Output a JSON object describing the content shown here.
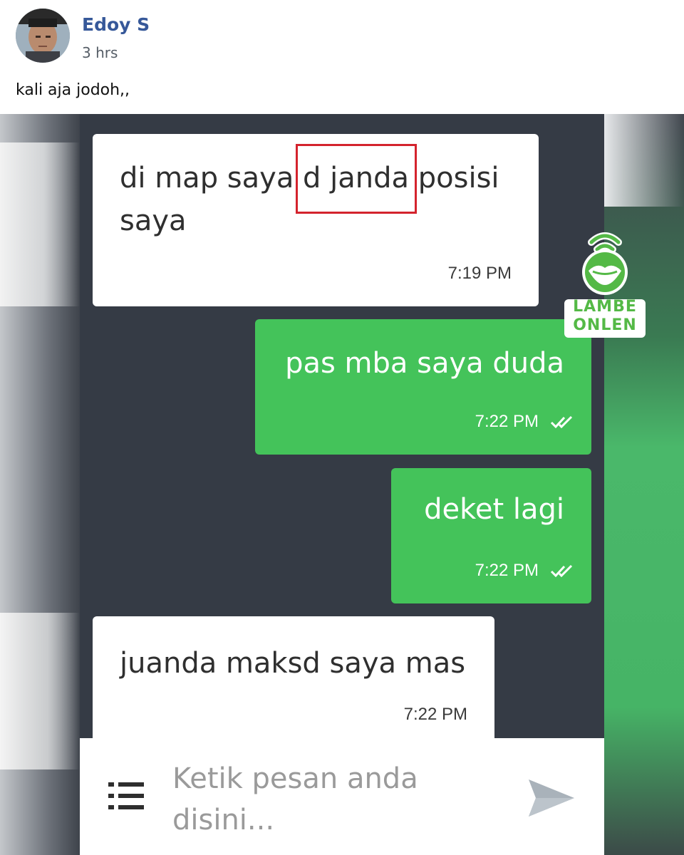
{
  "post": {
    "author": "Edoy S",
    "time": "3 hrs",
    "caption": "kali aja jodoh,,"
  },
  "chat": {
    "messages": [
      {
        "direction": "incoming",
        "lines": [
          "di map saya d janda posisi",
          "saya"
        ],
        "time": "7:19 PM",
        "highlight": "d janda"
      },
      {
        "direction": "outgoing",
        "text": "pas mba saya duda",
        "time": "7:22 PM",
        "status": "read"
      },
      {
        "direction": "outgoing",
        "text": "deket lagi",
        "time": "7:22 PM",
        "status": "read"
      },
      {
        "direction": "incoming",
        "text": "juanda maksd saya mas",
        "time": "7:22 PM"
      }
    ]
  },
  "input": {
    "placeholder_line1": "Ketik pesan anda",
    "placeholder_line2": "disini..."
  },
  "watermark": {
    "line1": "LAMBE",
    "line2": "ONLEN"
  },
  "colors": {
    "outgoing_bubble": "#44c35a",
    "incoming_bubble": "#ffffff",
    "chat_background": "#353b45",
    "highlight_border": "#d4232d",
    "author_name": "#365899"
  }
}
